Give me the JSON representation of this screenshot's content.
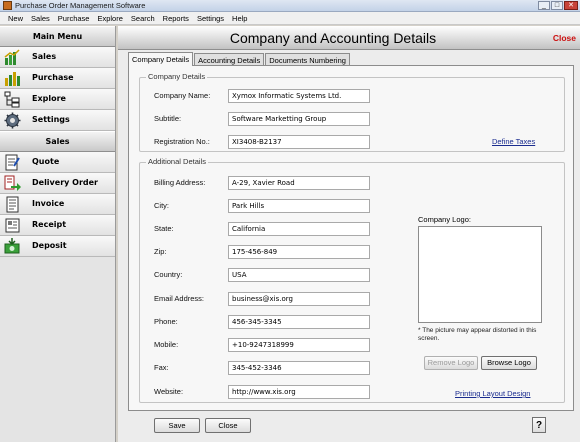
{
  "window": {
    "title": "Purchase Order Management Software",
    "controls": [
      "_",
      "□",
      "✕"
    ]
  },
  "menu": [
    "New",
    "Sales",
    "Purchase",
    "Explore",
    "Search",
    "Reports",
    "Settings",
    "Help"
  ],
  "sidebar": {
    "main_header": "Main Menu",
    "main_items": [
      {
        "label": "Sales",
        "icon": "sales-chart-icon"
      },
      {
        "label": "Purchase",
        "icon": "purchase-chart-icon"
      },
      {
        "label": "Explore",
        "icon": "explore-tree-icon"
      },
      {
        "label": "Settings",
        "icon": "gear-icon"
      }
    ],
    "sales_header": "Sales",
    "sales_items": [
      {
        "label": "Quote",
        "icon": "quote-icon"
      },
      {
        "label": "Delivery Order",
        "icon": "delivery-order-icon"
      },
      {
        "label": "Invoice",
        "icon": "invoice-icon"
      },
      {
        "label": "Receipt",
        "icon": "receipt-icon"
      },
      {
        "label": "Deposit",
        "icon": "deposit-icon"
      }
    ]
  },
  "header": {
    "title": "Company and Accounting Details",
    "close": "Close"
  },
  "tabs": [
    "Company Details",
    "Accounting Details",
    "Documents Numbering"
  ],
  "company": {
    "group_title": "Company Details",
    "name_label": "Company Name:",
    "name": "Xymox Informatic Systems Ltd.",
    "subtitle_label": "Subtitle:",
    "subtitle": "Software Marketting Group",
    "reg_label": "Registration No.:",
    "reg": "XI3408-B2137",
    "define_taxes": "Define Taxes"
  },
  "additional": {
    "group_title": "Additional Details",
    "fields": [
      {
        "label": "Billing Address:",
        "value": "A-29, Xavier Road"
      },
      {
        "label": "City:",
        "value": "Park Hills"
      },
      {
        "label": "State:",
        "value": "California"
      },
      {
        "label": "Zip:",
        "value": "175-456-849"
      },
      {
        "label": "Country:",
        "value": "USA"
      },
      {
        "label": "Email Address:",
        "value": "business@xis.org"
      },
      {
        "label": "Phone:",
        "value": "456-345-3345"
      },
      {
        "label": "Mobile:",
        "value": "+10-9247318999"
      },
      {
        "label": "Fax:",
        "value": "345-452-3346"
      },
      {
        "label": "Website:",
        "value": "http://www.xis.org"
      }
    ],
    "logo_label": "Company Logo:",
    "logo_note": "* The picture may appear distorted in this screen.",
    "remove_logo": "Remove Logo",
    "browse_logo": "Browse Logo",
    "printing_link": "Printing Layout Design"
  },
  "footer": {
    "save": "Save",
    "close": "Close",
    "help": "?"
  },
  "colors": {
    "close_red": "#cc1010",
    "link_blue": "#1a2c8f"
  }
}
